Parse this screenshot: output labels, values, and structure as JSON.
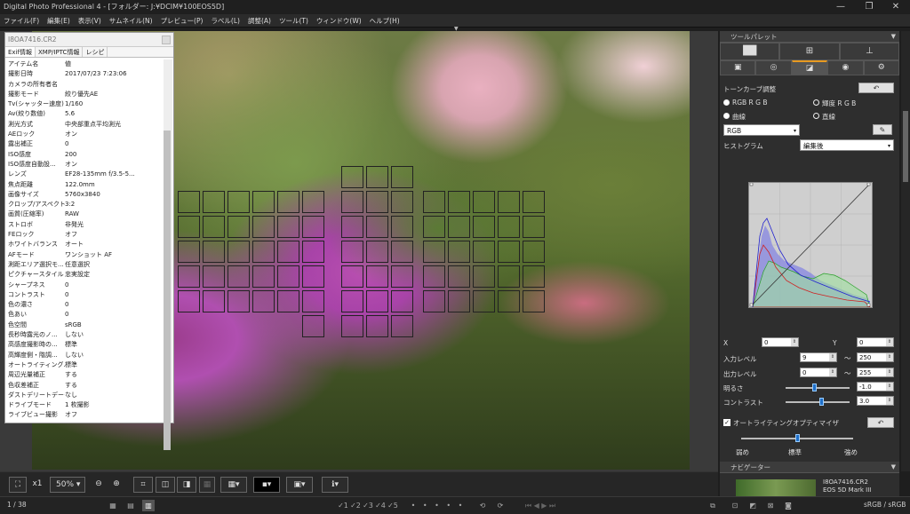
{
  "window": {
    "title": "Digital Photo Professional 4 - [フォルダー: J:¥DCIM¥100EOS5D]",
    "min_icon": "minimize-icon",
    "max_icon": "restore-icon",
    "close_icon": "close-icon"
  },
  "menu": [
    "ファイル(F)",
    "編集(E)",
    "表示(V)",
    "サムネイル(N)",
    "プレビュー(P)",
    "ラベル(L)",
    "調整(A)",
    "ツール(T)",
    "ウィンドウ(W)",
    "ヘルプ(H)"
  ],
  "exif": {
    "filename": "I8OA7416.CR2",
    "tabs": [
      "Exif情報",
      "XMP/IPTC情報",
      "レシピ"
    ],
    "rows": [
      [
        "アイテム名",
        "値"
      ],
      [
        "撮影日時",
        "2017/07/23 7:23:06"
      ],
      [
        "カメラの所有者名",
        ""
      ],
      [
        "撮影モード",
        "絞り優先AE"
      ],
      [
        "Tv(シャッター速度)",
        "1/160"
      ],
      [
        "Av(絞り数値)",
        "5.6"
      ],
      [
        "測光方式",
        "中央部重点平均測光"
      ],
      [
        "AEロック",
        "オン"
      ],
      [
        "露出補正",
        "0"
      ],
      [
        "ISO感度",
        "200"
      ],
      [
        "ISO感度自動設...",
        "オン"
      ],
      [
        "レンズ",
        "EF28-135mm f/3.5-5..."
      ],
      [
        "焦点距離",
        "122.0mm"
      ],
      [
        "画像サイズ",
        "5760x3840"
      ],
      [
        "クロップ/アスペクト",
        "3:2"
      ],
      [
        "画質(圧縮率)",
        "RAW"
      ],
      [
        "ストロボ",
        "非発光"
      ],
      [
        "FEロック",
        "オフ"
      ],
      [
        "ホワイトバランス",
        "オート"
      ],
      [
        "AFモード",
        "ワンショット AF"
      ],
      [
        "測距エリア選択モ...",
        "任意選択"
      ],
      [
        "ピクチャースタイル",
        "忠実設定"
      ],
      [
        "シャープネス",
        "0"
      ],
      [
        "コントラスト",
        "0"
      ],
      [
        "色の濃さ",
        "0"
      ],
      [
        "色あい",
        "0"
      ],
      [
        "色空間",
        "sRGB"
      ],
      [
        "長秒時露光のノ...",
        "しない"
      ],
      [
        "高感度撮影時の...",
        "標準"
      ],
      [
        "高輝度側・階調...",
        "しない"
      ],
      [
        "オートライティング...",
        "標準"
      ],
      [
        "周辺光量補正",
        "する"
      ],
      [
        "色収差補正",
        "する"
      ],
      [
        "ダストデリートデータ",
        "なし"
      ],
      [
        "ドライブモード",
        "1 枚撮影"
      ],
      [
        "ライブビュー撮影",
        "オフ"
      ]
    ]
  },
  "toolbar": {
    "fit_icon": "fit-screen-icon",
    "x1": "x1",
    "zoom": "50%",
    "zoom_out_icon": "zoom-out-icon",
    "zoom_in_icon": "zoom-in-icon"
  },
  "rightpanel": {
    "header": "ツールパレット",
    "tabs_row1_icons": [
      "levels-icon",
      "crop-icon",
      "stamp-icon"
    ],
    "tabs_row2_icons": [
      "basic-icon",
      "lens-icon",
      "tone-curve-icon",
      "color-icon",
      "settings-icon"
    ],
    "tone_title": "トーンカーブ調整",
    "opt_rgb": "RGB R G B",
    "opt_lum": "輝度 R G B",
    "opt_curve": "曲線",
    "opt_line": "直線",
    "channel": "RGB",
    "histogram_label": "ヒストグラム",
    "histogram_mode": "編集後",
    "x_label": "X",
    "x_value": "0",
    "y_label": "Y",
    "y_value": "0",
    "input_label": "入力レベル",
    "input_min": "9",
    "input_max": "250",
    "output_label": "出力レベル",
    "output_min": "0",
    "output_max": "255",
    "brightness_label": "明るさ",
    "brightness_value": "-1.0",
    "brightness_level": 0.45,
    "contrast_label": "コントラスト",
    "contrast_value": "3.0",
    "contrast_level": 0.55,
    "tilde": "～",
    "alo_label": "オートライティングオプティマイザ",
    "alo_levels": [
      "弱め",
      "標準",
      "強め"
    ],
    "alo_level": 0.5
  },
  "navigator": {
    "header": "ナビゲーター",
    "file": "I8OA7416.CR2",
    "camera": "EOS 5D Mark III"
  },
  "status": {
    "count": "1 / 38",
    "colorspace": "sRGB / sRGB",
    "rating_marks": [
      "✓1",
      "✓2",
      "✓3",
      "✓4",
      "✓5"
    ]
  },
  "colors": {
    "accent": "#e89a20",
    "slider": "#1f6fc8"
  }
}
